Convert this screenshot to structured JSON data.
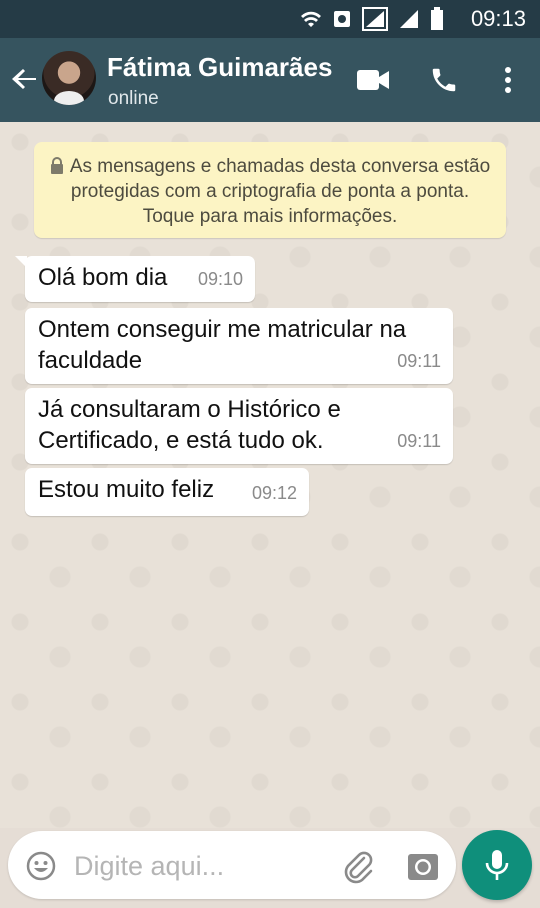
{
  "status_bar": {
    "time": "09:13",
    "icons": [
      "wifi-icon",
      "hotspot-icon",
      "signal-icon",
      "signal-icon",
      "battery-icon"
    ]
  },
  "header": {
    "contact_name": "Fátima Guimarães",
    "status": "online",
    "actions": [
      "back-arrow-icon",
      "video-call-icon",
      "phone-icon",
      "more-vert-icon"
    ],
    "color": "#36545f",
    "status_bar_color": "#253b46"
  },
  "chat": {
    "encryption_notice": "As mensagens e chamadas desta conversa estão protegidas com a criptografia de ponta a ponta. Toque para mais informações.",
    "messages": [
      {
        "text": "Olá bom dia",
        "time": "09:10"
      },
      {
        "text": "Ontem conseguir me matricular na faculdade",
        "time": "09:11"
      },
      {
        "text": "Já consultaram o Histórico e Certificado, e está tudo ok.",
        "time": "09:11"
      },
      {
        "text": "Estou muito feliz",
        "time": "09:12"
      }
    ],
    "background_color": "#e8e1d8",
    "notice_color": "#fcf4c4"
  },
  "input": {
    "placeholder": "Digite aqui...",
    "icons": [
      "emoji-icon",
      "attach-icon",
      "camera-icon",
      "mic-icon"
    ],
    "mic_color": "#0f8f7b"
  }
}
